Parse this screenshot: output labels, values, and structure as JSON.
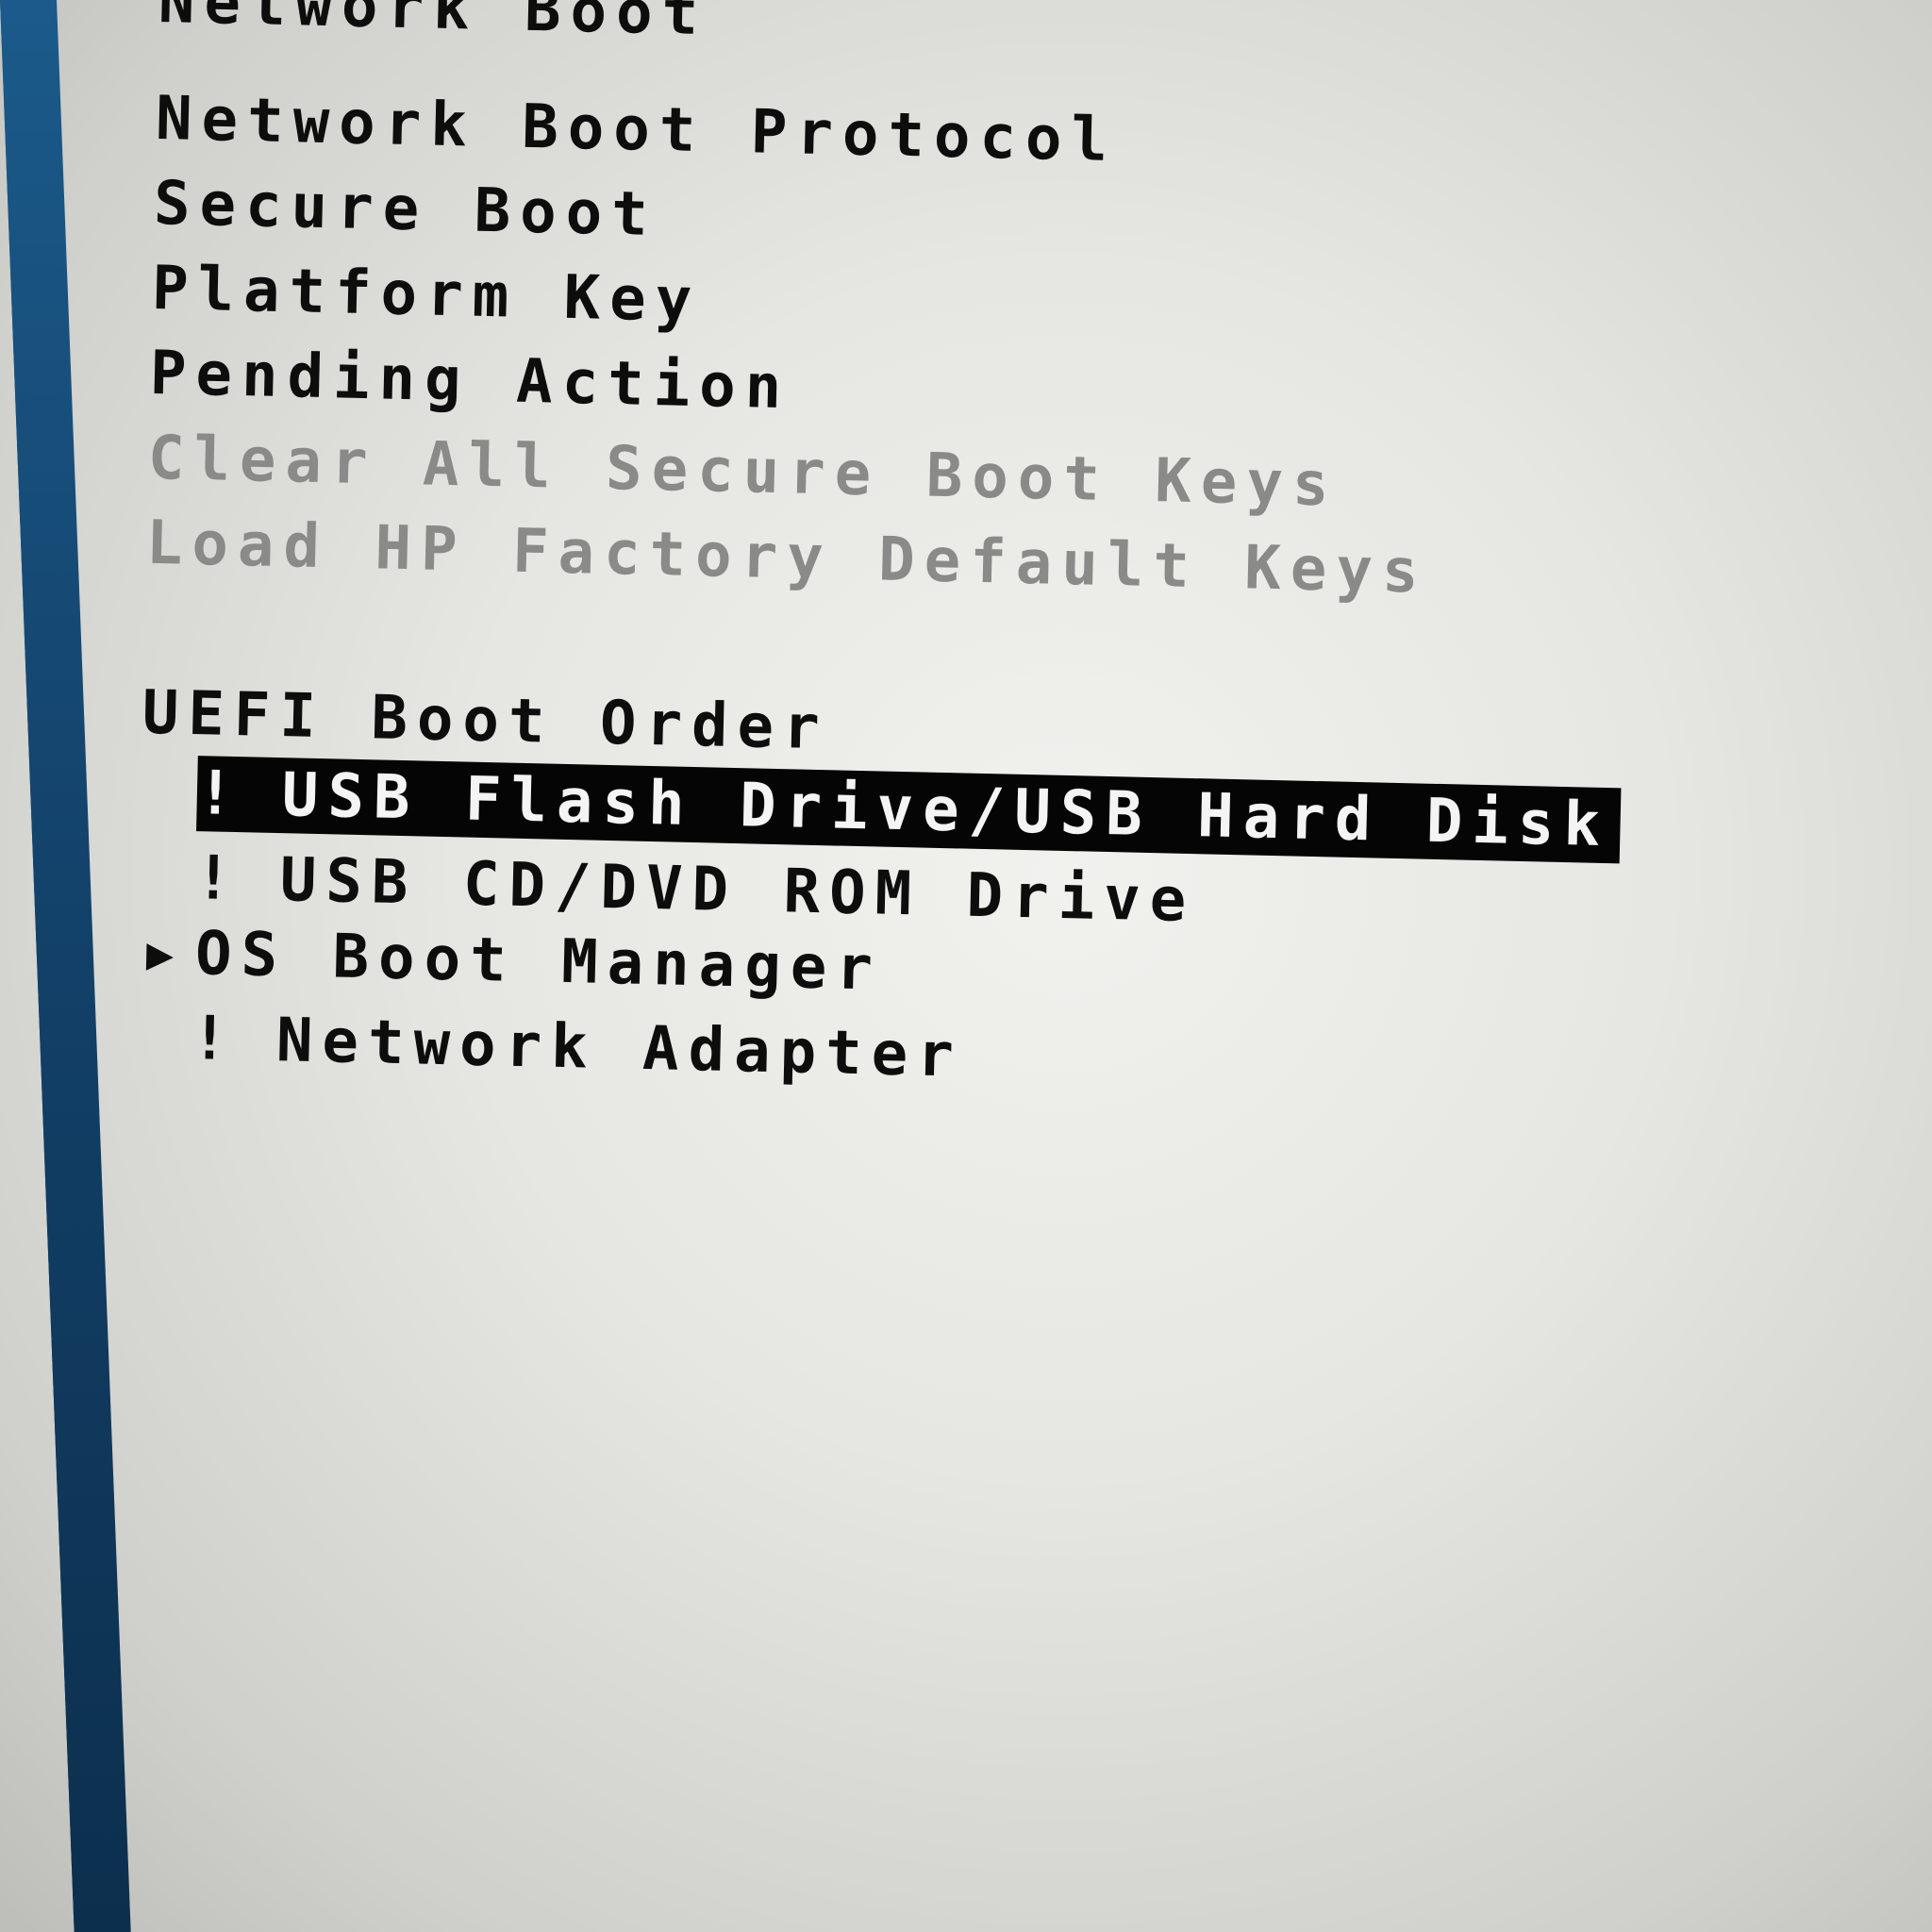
{
  "security_menu": {
    "items": [
      {
        "label": "Network Boot",
        "state": "enabled"
      },
      {
        "label": "Network Boot Protocol",
        "state": "enabled"
      },
      {
        "label": "Secure Boot",
        "state": "enabled"
      },
      {
        "label": "Platform Key",
        "state": "enabled"
      },
      {
        "label": "Pending Action",
        "state": "enabled"
      },
      {
        "label": "Clear All Secure Boot Keys",
        "state": "disabled"
      },
      {
        "label": "Load HP Factory Default Keys",
        "state": "disabled"
      }
    ]
  },
  "boot_order": {
    "title": "UEFI Boot Order",
    "items": [
      {
        "marker": "!",
        "label": "USB Flash Drive/USB Hard Disk",
        "selected": true
      },
      {
        "marker": "!",
        "label": "USB CD/DVD ROM Drive",
        "selected": false
      },
      {
        "marker": "▶",
        "label": "OS Boot Manager",
        "selected": false
      },
      {
        "marker": "!",
        "label": "Network Adapter",
        "selected": false
      }
    ]
  },
  "colors": {
    "background": "#e6e6e2",
    "text": "#0d0d0d",
    "disabled_text": "#8a8a88",
    "selection_bg": "#050505",
    "selection_text": "#f4f4f4",
    "frame_border": "#14466e"
  }
}
